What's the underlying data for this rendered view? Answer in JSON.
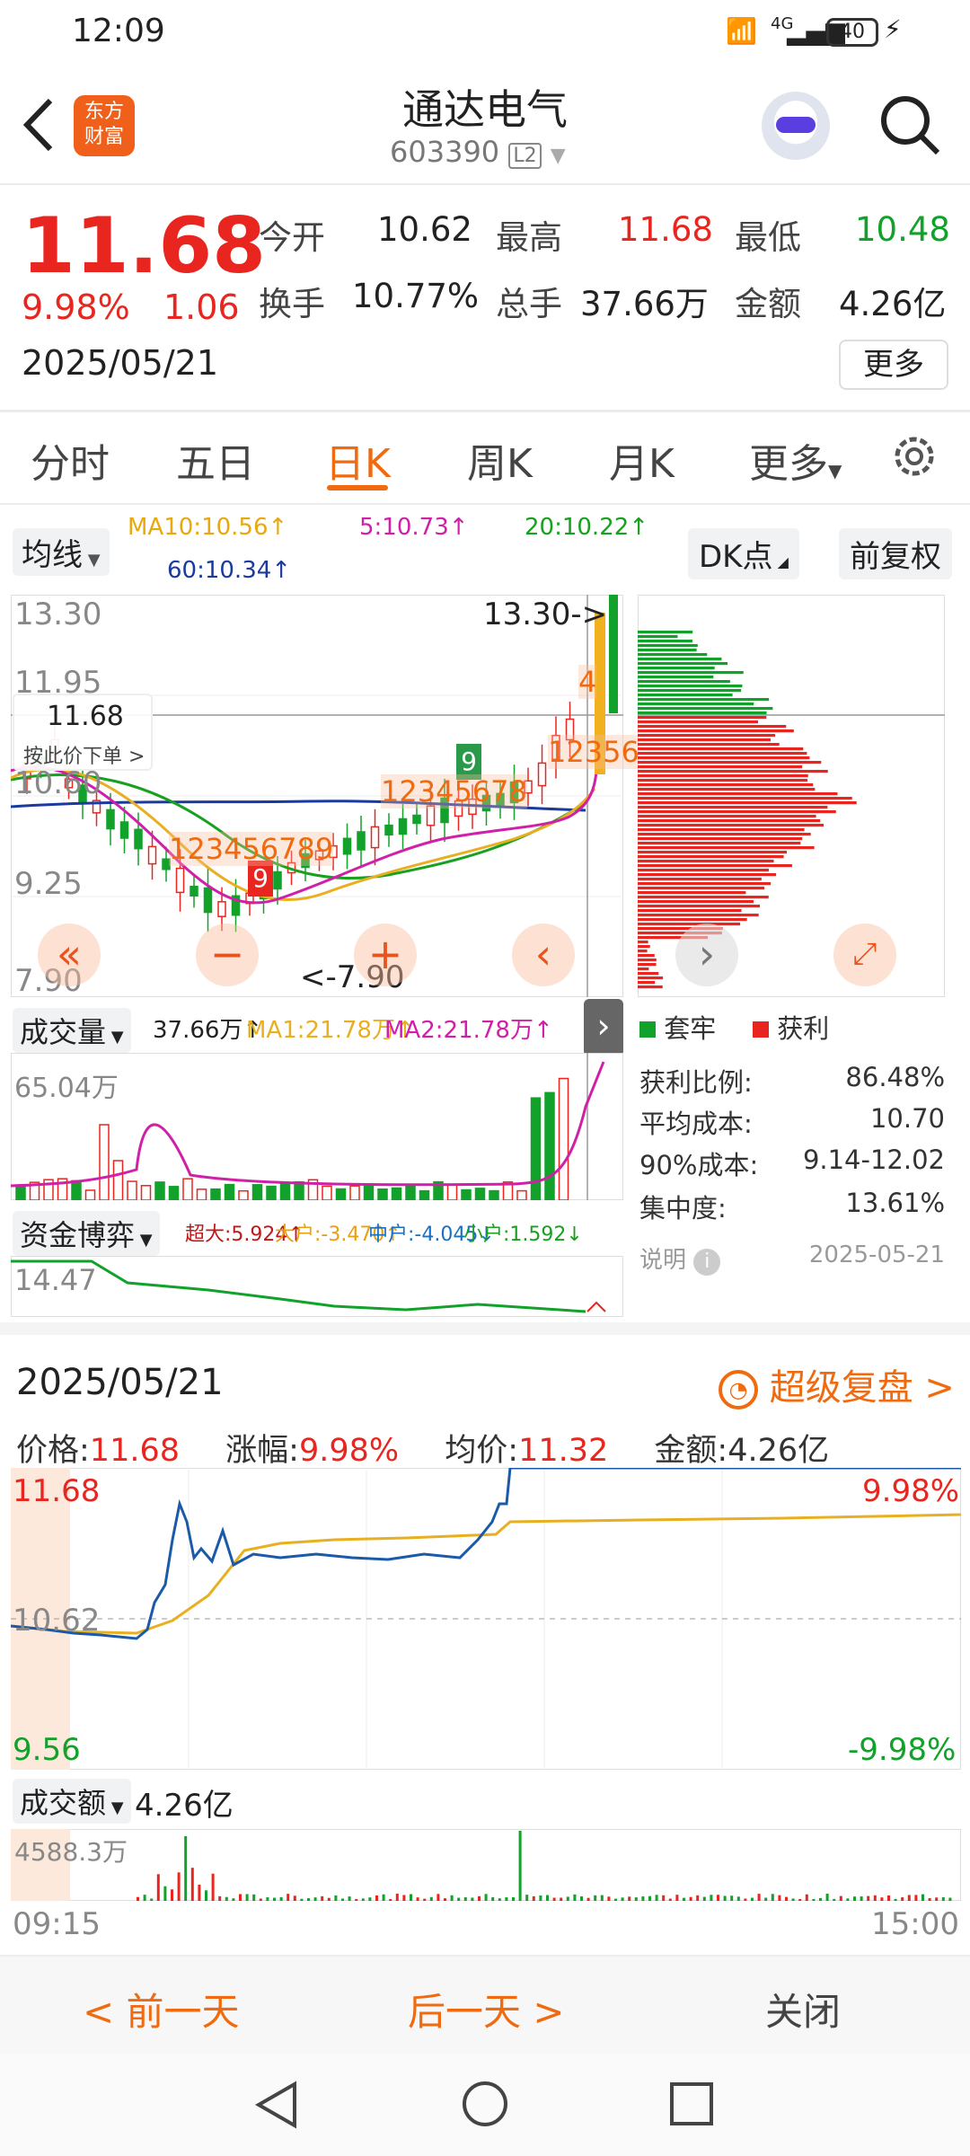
{
  "status_bar": {
    "time": "12:09",
    "network": "4G",
    "battery": "40"
  },
  "header": {
    "back_label": "<",
    "logo_line1": "东方",
    "logo_line2": "财富",
    "title": "通达电气",
    "code": "603390",
    "level_badge": "L2"
  },
  "quote": {
    "price": "11.68",
    "change_pct": "9.98%",
    "change": "1.06",
    "date": "2025/05/21",
    "open_label": "今开",
    "open": "10.62",
    "high_label": "最高",
    "high": "11.68",
    "low_label": "最低",
    "low": "10.48",
    "turnover_label": "换手",
    "turnover": "10.77%",
    "volume_label": "总手",
    "volume": "37.66万",
    "amount_label": "金额",
    "amount": "4.26亿",
    "more_button": "更多"
  },
  "tabs": [
    "分时",
    "五日",
    "日K",
    "周K",
    "月K",
    "更多"
  ],
  "active_tab": 2,
  "kline": {
    "ma_selector": "均线",
    "ma10": "MA10:10.56↑",
    "ma5": "5:10.73↑",
    "ma20": "20:10.22↑",
    "ma60": "60:10.34↑",
    "dk_button": "DK点",
    "fq_button": "前复权",
    "y_top": "13.30",
    "y_mid1": "11.95",
    "y_mid2": "10.60",
    "y_low": "9.25",
    "y_bottom": "7.90",
    "max_marker": "13.30->",
    "min_marker": "<-7.90",
    "cursor_price": "11.68",
    "cursor_hint": "按此价下单 >",
    "colors": {
      "up": "#e8261f",
      "down": "#12a12a",
      "ma5": "#d020a8",
      "ma10": "#e8b020",
      "ma20": "#18a020",
      "ma60": "#1a3aa0"
    }
  },
  "chip_panel": {
    "legend_trapped": "套牢",
    "legend_profit": "获利",
    "rows": [
      {
        "label": "获利比例:",
        "value": "86.48%"
      },
      {
        "label": "平均成本:",
        "value": "10.70"
      },
      {
        "label": "90%成本:",
        "value": "9.14-12.02"
      },
      {
        "label": "集中度:",
        "value": "13.61%"
      }
    ],
    "note_label": "说明",
    "note_date": "2025-05-21"
  },
  "volume_panel": {
    "selector": "成交量",
    "vol": "37.66万↑",
    "ma1": "MA1:21.78万↑",
    "ma2": "MA2:21.78万↑",
    "y_max": "65.04万"
  },
  "fund_panel": {
    "selector": "资金博弈",
    "super": "超大:5.924↑",
    "large": "大户:-3.470↑",
    "mid": "中户:-4.045↓",
    "small": "小户:1.592↓",
    "y_top": "14.47"
  },
  "intraday": {
    "date": "2025/05/21",
    "replay_label": "超级复盘 >",
    "price_label": "价格:",
    "price": "11.68",
    "pct_label": "涨幅:",
    "pct": "9.98%",
    "avg_label": "均价:",
    "avg": "11.32",
    "amount_label": "金额:",
    "amount": "4.26亿",
    "y_high": "11.68",
    "y_mid": "10.62",
    "y_low": "9.56",
    "pct_high": "9.98%",
    "pct_low": "-9.98%",
    "amount_selector": "成交额",
    "amount_total": "4.26亿",
    "amount_max": "4588.3万",
    "time_start": "09:15",
    "time_end": "15:00"
  },
  "bottom_bar": {
    "prev": "< 前一天",
    "next": "后一天 >",
    "close": "关闭"
  }
}
